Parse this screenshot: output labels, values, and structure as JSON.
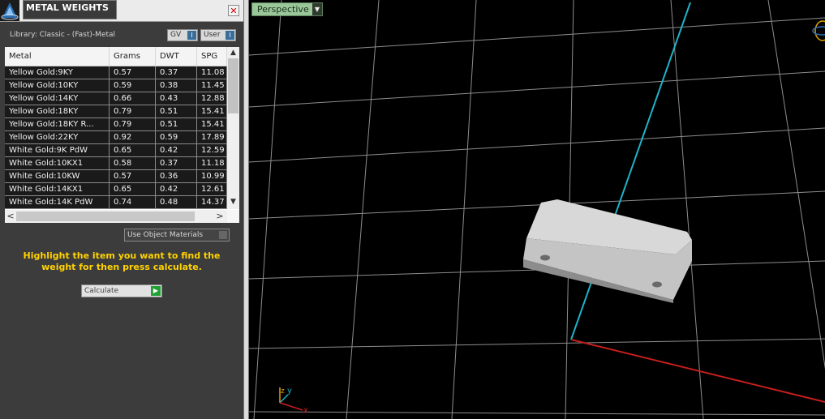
{
  "panel": {
    "title": "METAL WEIGHTS",
    "close_glyph": "✕",
    "library": "Library: Classic - (Fast)-Metal",
    "toggles": [
      {
        "label": "GV",
        "knob": "I"
      },
      {
        "label": "User",
        "knob": "I"
      }
    ],
    "table": {
      "headers": [
        "Metal",
        "Grams",
        "DWT",
        "SPG"
      ],
      "rows": [
        [
          "Yellow Gold:9KY",
          "0.57",
          "0.37",
          "11.08"
        ],
        [
          "Yellow Gold:10KY",
          "0.59",
          "0.38",
          "11.45"
        ],
        [
          "Yellow Gold:14KY",
          "0.66",
          "0.43",
          "12.88"
        ],
        [
          "Yellow Gold:18KY",
          "0.79",
          "0.51",
          "15.41"
        ],
        [
          "Yellow Gold:18KY R...",
          "0.79",
          "0.51",
          "15.41"
        ],
        [
          "Yellow Gold:22KY",
          "0.92",
          "0.59",
          "17.89"
        ],
        [
          "White Gold:9K PdW",
          "0.65",
          "0.42",
          "12.59"
        ],
        [
          "White Gold:10KX1",
          "0.58",
          "0.37",
          "11.18"
        ],
        [
          "White Gold:10KW",
          "0.57",
          "0.36",
          "10.99"
        ],
        [
          "White Gold:14KX1",
          "0.65",
          "0.42",
          "12.61"
        ],
        [
          "White Gold:14K PdW",
          "0.74",
          "0.48",
          "14.37"
        ]
      ],
      "scroll_up": "▲",
      "scroll_down": "▼",
      "scroll_left": "<",
      "scroll_right": ">"
    },
    "use_object_materials": "Use Object Materials",
    "hint": "Highlight the item you want to find the weight for then press calculate.",
    "calculate_label": "Calculate",
    "calculate_icon": "▶"
  },
  "viewport": {
    "view_label": "Perspective",
    "view_dropdown": "▼",
    "axis_labels": {
      "z": "z",
      "y": "y",
      "x": "x"
    },
    "colors": {
      "grid": "#8d8d8d",
      "y_axis": "#1fb3c9",
      "x_axis": "#c81e1e",
      "panel_bg": "#3c3c3c",
      "hint_text": "#ffd200",
      "perspective_bg": "#9ac79a"
    },
    "icons": [
      "perspective-dropdown-icon",
      "axis-triad-icon",
      "navigation-gizmo-icon",
      "app-logo-icon"
    ]
  }
}
